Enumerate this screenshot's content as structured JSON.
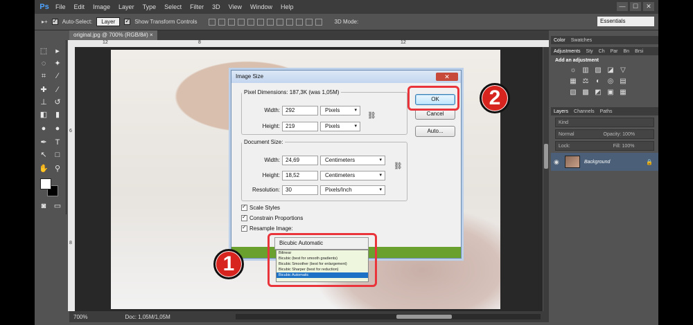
{
  "app": {
    "logo": "Ps"
  },
  "menu": [
    "File",
    "Edit",
    "Image",
    "Layer",
    "Type",
    "Select",
    "Filter",
    "3D",
    "View",
    "Window",
    "Help"
  ],
  "window_buttons": [
    "—",
    "☐",
    "✕"
  ],
  "options": {
    "auto_select_label": "Auto-Select:",
    "auto_select_value": "Layer",
    "transform_label": "Show Transform Controls",
    "mode_3d_label": "3D Mode:",
    "workspace": "Essentials"
  },
  "document_tab": "original.jpg @ 700% (RGB/8#)",
  "ruler": {
    "top_marks": [
      "12",
      "8",
      "12"
    ],
    "left_marks": [
      "6",
      "8"
    ]
  },
  "status": {
    "zoom": "700%",
    "doc": "Doc: 1,05M/1,05M"
  },
  "panels": {
    "top_tabs": [
      "Color",
      "Swatches"
    ],
    "adj_tabs": [
      "Adjustments",
      "Sty",
      "Ch",
      "Par",
      "Bn",
      "Brsi"
    ],
    "adj_header": "Add an adjustment",
    "adj_icons": [
      "☼",
      "▥",
      "▨",
      "◪",
      "▽",
      "▦",
      "⚖",
      "◐",
      "◎",
      "▤",
      "▧",
      "▩",
      "◩",
      "▣",
      "▦"
    ],
    "layer_tabs": [
      "Layers",
      "Channels",
      "Paths"
    ],
    "kind_label": "Kind",
    "blend_mode": "Normal",
    "opacity_label": "Opacity:",
    "opacity_value": "100%",
    "lock_label": "Lock:",
    "fill_label": "Fill:",
    "fill_value": "100%",
    "layer_name": "Background"
  },
  "dialog": {
    "title": "Image Size",
    "close": "✕",
    "pixel_dimensions_legend": "Pixel Dimensions:  187,3K (was 1,05M)",
    "width_label": "Width:",
    "height_label": "Height:",
    "px_width": "292",
    "px_height": "219",
    "px_unit": "Pixels",
    "doc_size_legend": "Document Size:",
    "doc_width": "24,69",
    "doc_height": "18,52",
    "doc_unit": "Centimeters",
    "resolution_label": "Resolution:",
    "resolution": "30",
    "res_unit": "Pixels/Inch",
    "ok": "OK",
    "cancel": "Cancel",
    "auto": "Auto...",
    "scale_styles": "Scale Styles",
    "constrain": "Constrain Proportions",
    "resample": "Resample Image:",
    "resample_value": "Bicubic Automatic",
    "dropdown": [
      "Bilinear",
      "Bicubic (best for smooth gradients)",
      "Bicubic Smoother (best for enlargement)",
      "Bicubic Sharper (best for reduction)",
      "Bicubic Automatic"
    ]
  },
  "callouts": {
    "step1": "1",
    "step2": "2"
  }
}
